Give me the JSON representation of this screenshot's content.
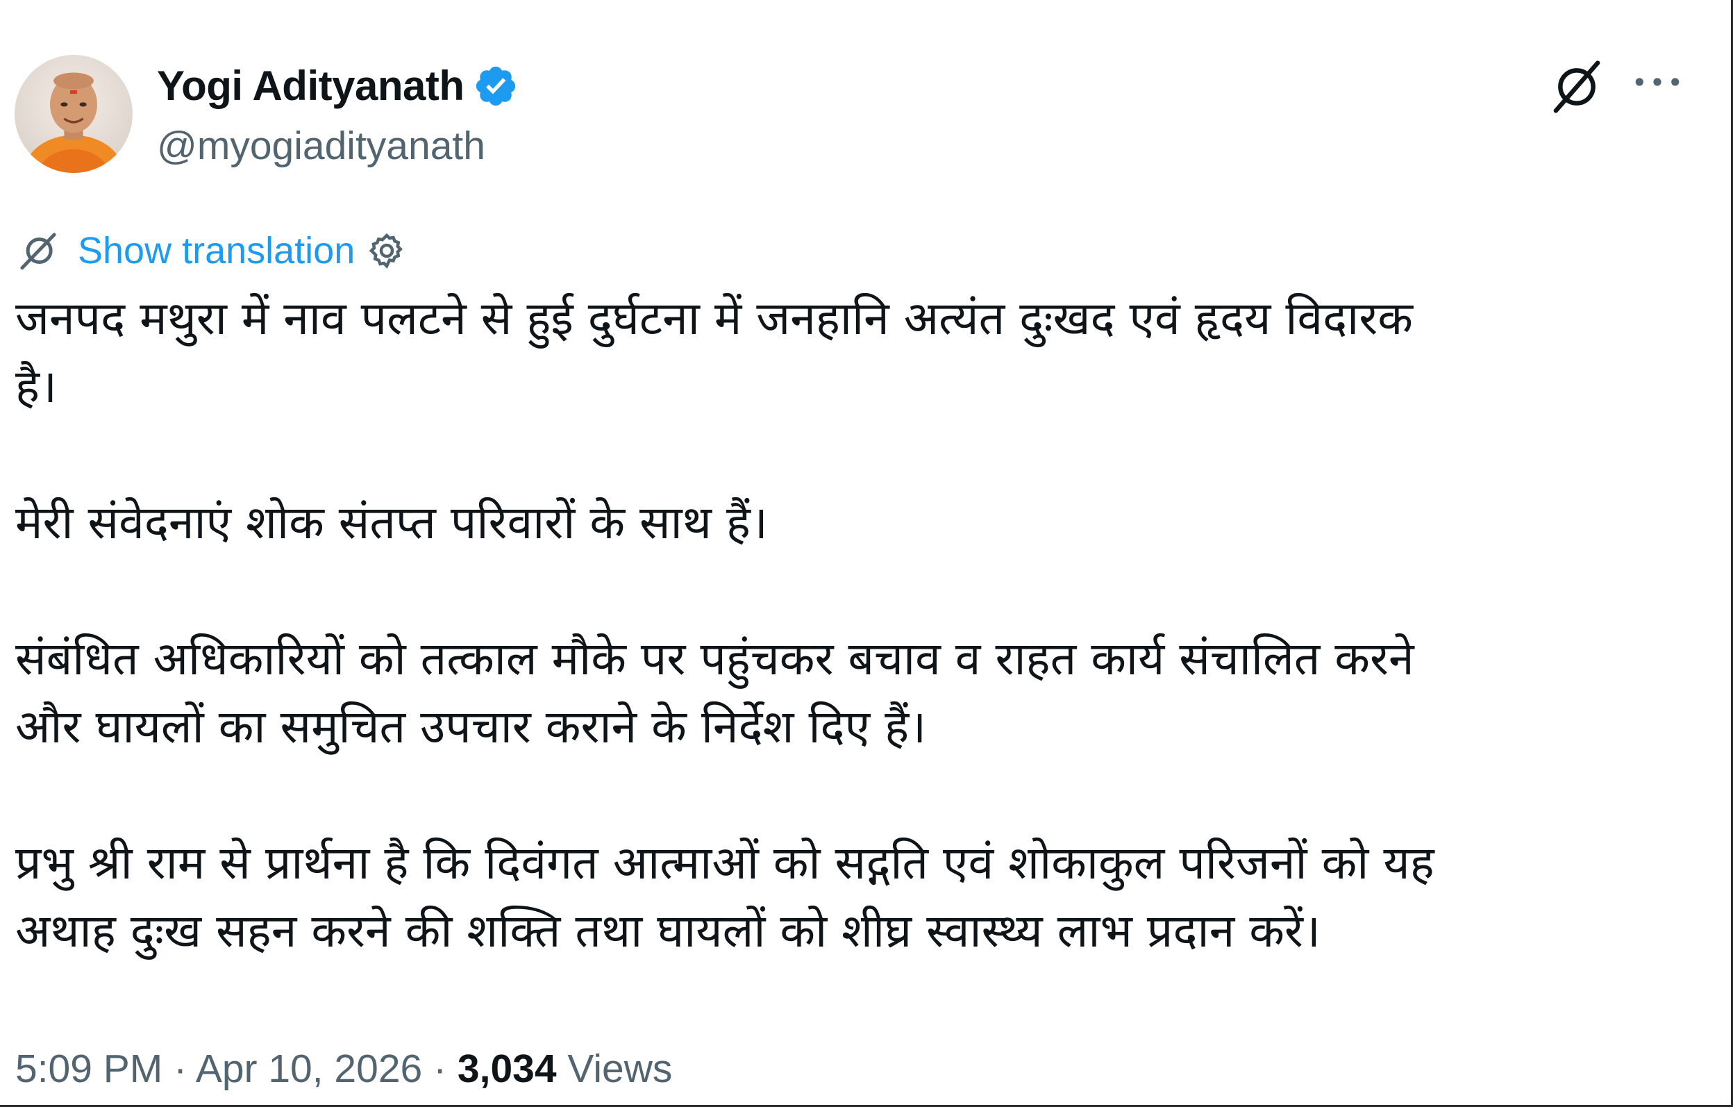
{
  "author": {
    "display_name": "Yogi Adityanath",
    "handle": "@myogiadityanath",
    "verified": true,
    "avatar_icon": "profile-photo"
  },
  "actions": {
    "grok_icon": "grok-icon",
    "more_icon": "more-options-icon"
  },
  "translation": {
    "label": "Show translation",
    "icon": "grok-translate-icon",
    "settings_icon": "gear-icon"
  },
  "tweet": {
    "lines": [
      "जनपद मथुरा में नाव पलटने से हुई दुर्घटना में जनहानि अत्यंत दुःखद एवं हृदय विदारक",
      "है।",
      "",
      "मेरी संवेदनाएं शोक संतप्त परिवारों के साथ हैं।",
      "",
      "संबंधित अधिकारियों को तत्काल मौके पर पहुंचकर बचाव व राहत कार्य संचालित करने",
      "और घायलों का समुचित उपचार कराने के निर्देश दिए हैं।",
      "",
      "प्रभु श्री राम से प्रार्थना है कि दिवंगत आत्माओं को सद्गति एवं शोकाकुल परिजनों को यह",
      "अथाह दुःख सहन करने की शक्ति तथा घायलों को शीघ्र स्वास्थ्य लाभ प्रदान करें।"
    ]
  },
  "meta": {
    "time": "5:09 PM",
    "separator": "·",
    "date": "Apr 10, 2026",
    "views_count": "3,034",
    "views_label": "Views"
  },
  "colors": {
    "link": "#1d9bf0",
    "secondary_text": "#536471",
    "primary_text": "#0f1419"
  }
}
